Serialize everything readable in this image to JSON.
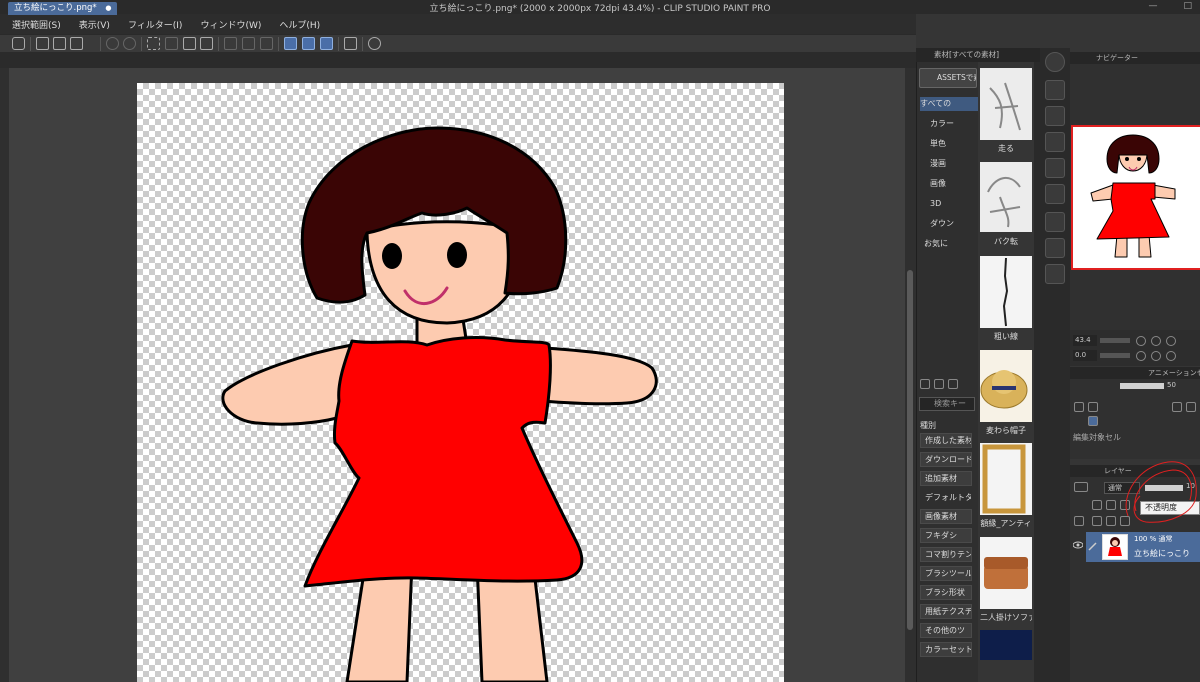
{
  "app": {
    "title": "立ち絵にっこり.png* (2000 x 2000px 72dpi 43.4%)  - CLIP STUDIO PAINT PRO",
    "window_controls": [
      "—",
      "□"
    ]
  },
  "menu": {
    "items": [
      "選択範囲(S)",
      "表示(V)",
      "フィルター(I)",
      "ウィンドウ(W)",
      "ヘルプ(H)"
    ]
  },
  "document": {
    "tab_label": "立ち絵にっこり.png*",
    "tab_close": "●"
  },
  "assets": {
    "panel_header": "素材[すべての素材]",
    "assets_button": "ASSETSで素",
    "tree": [
      "すべての",
      "カラー",
      "単色",
      "漫画",
      "画像",
      "3D",
      "ダウン",
      "お気に"
    ],
    "thumbnails": [
      "走る",
      "バク転",
      "粗い線",
      "麦わら帽子",
      "額縁_アンティ",
      "二人掛けソファ",
      ""
    ],
    "search_placeholder": "検索キー",
    "kind_label": "種別",
    "kinds": [
      "作成した素材",
      "ダウンロード",
      "追加素材",
      "デフォルトタ...",
      "画像素材",
      "フキダシ",
      "コマ割りテン",
      "ブラシツール",
      "ブラシ形状",
      "用紙テクスチ",
      "その他のツ",
      "カラーセット"
    ]
  },
  "navigator": {
    "header": "ナビゲーター",
    "zoom": "43.4",
    "rotation": "0.0"
  },
  "animation": {
    "header": "アニメーションセル",
    "opacity": "50",
    "edit_cel_label": "編集対象セル"
  },
  "layers": {
    "header": "レイヤー",
    "blend_mode": "通常",
    "opacity": "10",
    "tooltip": "不透明度",
    "row": {
      "info": "100 % 通常",
      "name": "立ち絵にっこり"
    }
  },
  "colors": {
    "accent": "#4b6b9a",
    "dress": "#ff0000",
    "hair": "#3a0505",
    "skin": "#fdcbb0"
  },
  "icons": [
    "clip-logo-icon",
    "new-file-icon",
    "open-folder-icon",
    "save-icon",
    "undo-icon",
    "redo-icon",
    "lasso-icon",
    "fill-icon",
    "transform-icon",
    "ruler-icon",
    "help-icon",
    "eye-icon",
    "pen-icon"
  ]
}
